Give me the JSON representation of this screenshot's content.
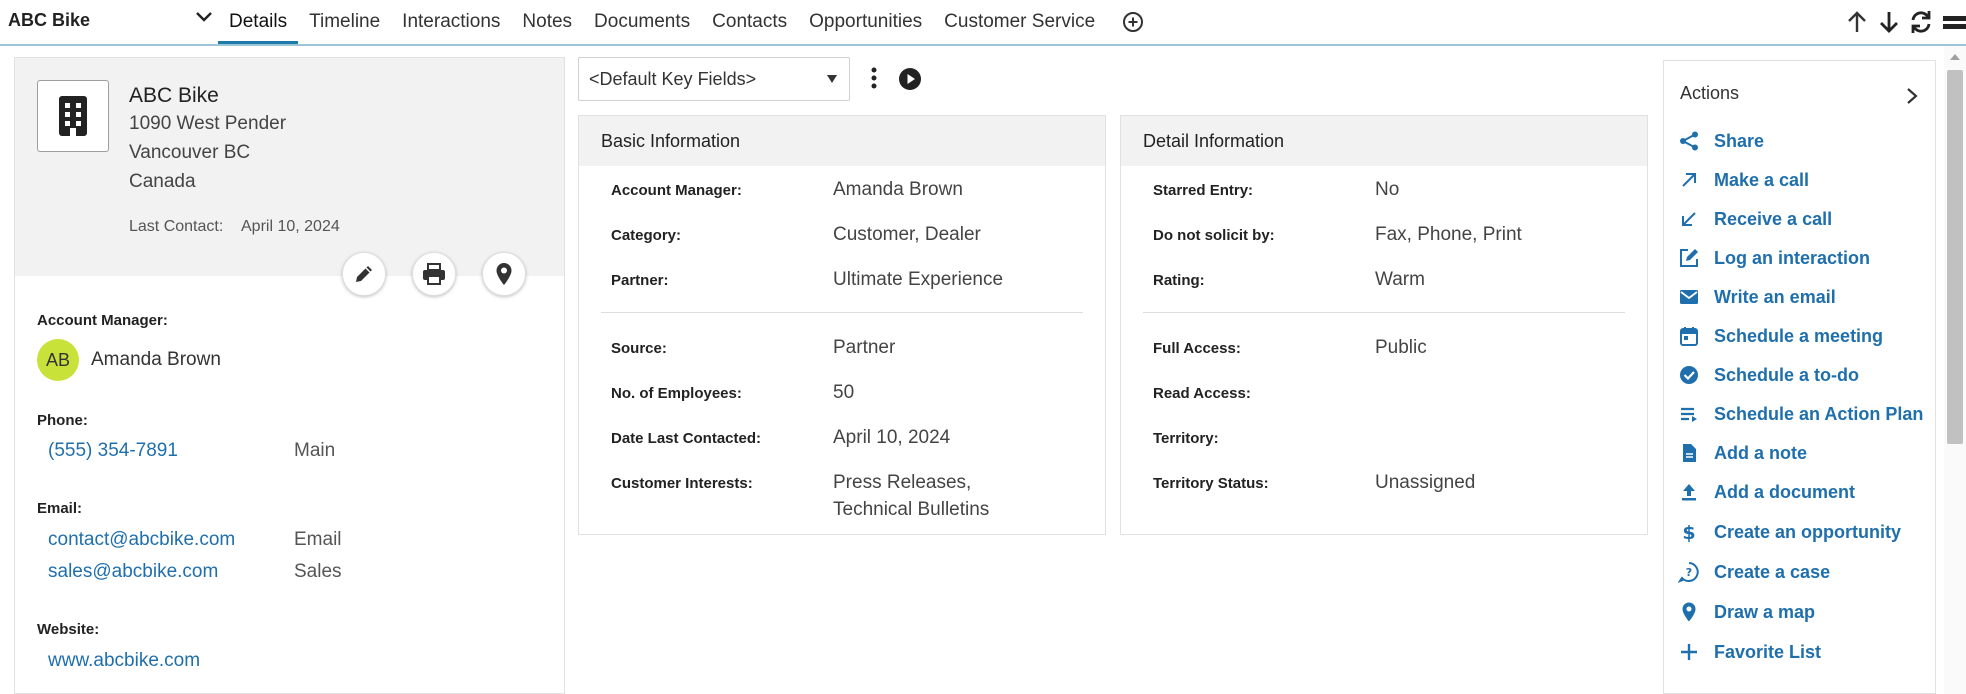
{
  "header": {
    "account_name": "ABC Bike",
    "tabs": [
      {
        "label": "Details",
        "active": true
      },
      {
        "label": "Timeline"
      },
      {
        "label": "Interactions"
      },
      {
        "label": "Notes"
      },
      {
        "label": "Documents"
      },
      {
        "label": "Contacts"
      },
      {
        "label": "Opportunities"
      },
      {
        "label": "Customer Service"
      }
    ],
    "add_tab_icon": "plus-circle-icon",
    "nav_icons": [
      "arrow-up-icon",
      "arrow-down-icon",
      "refresh-icon",
      "layout-icon"
    ]
  },
  "company": {
    "name": "ABC Bike",
    "address_line1": "1090 West Pender",
    "address_line2": "Vancouver BC",
    "address_line3": "Canada",
    "last_contact_label": "Last Contact:",
    "last_contact_value": "April 10, 2024",
    "action_icons": [
      "edit-icon",
      "print-icon",
      "map-pin-icon"
    ]
  },
  "contact_fields": {
    "account_manager_label": "Account Manager:",
    "account_manager_initials": "AB",
    "account_manager_name": "Amanda Brown",
    "phone_label": "Phone:",
    "phone_number": "(555) 354-7891",
    "phone_type": "Main",
    "email_label": "Email:",
    "emails": [
      {
        "address": "contact@abcbike.com",
        "type": "Email"
      },
      {
        "address": "sales@abcbike.com",
        "type": "Sales"
      }
    ],
    "website_label": "Website:",
    "website": "www.abcbike.com"
  },
  "key_fields": {
    "selected": "<Default Key Fields>"
  },
  "basic_info": {
    "title": "Basic Information",
    "rows": [
      {
        "label": "Account Manager:",
        "value": "Amanda Brown"
      },
      {
        "label": "Category:",
        "value": "Customer, Dealer"
      },
      {
        "label": "Partner:",
        "value": "Ultimate Experience"
      },
      {
        "label": "Source:",
        "value": "Partner"
      },
      {
        "label": "No. of Employees:",
        "value": "50"
      },
      {
        "label": "Date Last Contacted:",
        "value": "April 10, 2024"
      },
      {
        "label": "Customer Interests:",
        "value": "Press Releases,",
        "value2": "Technical Bulletins"
      }
    ]
  },
  "detail_info": {
    "title": "Detail Information",
    "rows": [
      {
        "label": "Starred Entry:",
        "value": "No"
      },
      {
        "label": "Do not solicit by:",
        "value": "Fax, Phone, Print"
      },
      {
        "label": "Rating:",
        "value": "Warm"
      },
      {
        "label": "Full Access:",
        "value": "Public"
      },
      {
        "label": "Read Access:",
        "value": ""
      },
      {
        "label": "Territory:",
        "value": ""
      },
      {
        "label": "Territory Status:",
        "value": "Unassigned"
      }
    ]
  },
  "actions": {
    "title": "Actions",
    "items": [
      {
        "label": "Share",
        "icon": "share-icon"
      },
      {
        "label": "Make a call",
        "icon": "outgoing-call-icon"
      },
      {
        "label": "Receive a call",
        "icon": "incoming-call-icon"
      },
      {
        "label": "Log an interaction",
        "icon": "edit-square-icon"
      },
      {
        "label": "Write an email",
        "icon": "mail-icon"
      },
      {
        "label": "Schedule a meeting",
        "icon": "calendar-icon"
      },
      {
        "label": "Schedule a to-do",
        "icon": "check-circle-icon"
      },
      {
        "label": "Schedule an Action Plan",
        "icon": "playlist-icon"
      },
      {
        "label": "Add a note",
        "icon": "note-icon"
      },
      {
        "label": "Add a document",
        "icon": "upload-icon"
      },
      {
        "label": "Create an opportunity",
        "icon": "dollar-icon"
      },
      {
        "label": "Create a case",
        "icon": "help-bubble-icon"
      },
      {
        "label": "Draw a map",
        "icon": "map-pin-icon"
      },
      {
        "label": "Favorite List",
        "icon": "plus-icon"
      }
    ]
  },
  "colors": {
    "accent": "#1e7aa8",
    "link": "#1f6fad",
    "avatar": "#c8e23a",
    "panel_header": "#f2f2f2"
  }
}
